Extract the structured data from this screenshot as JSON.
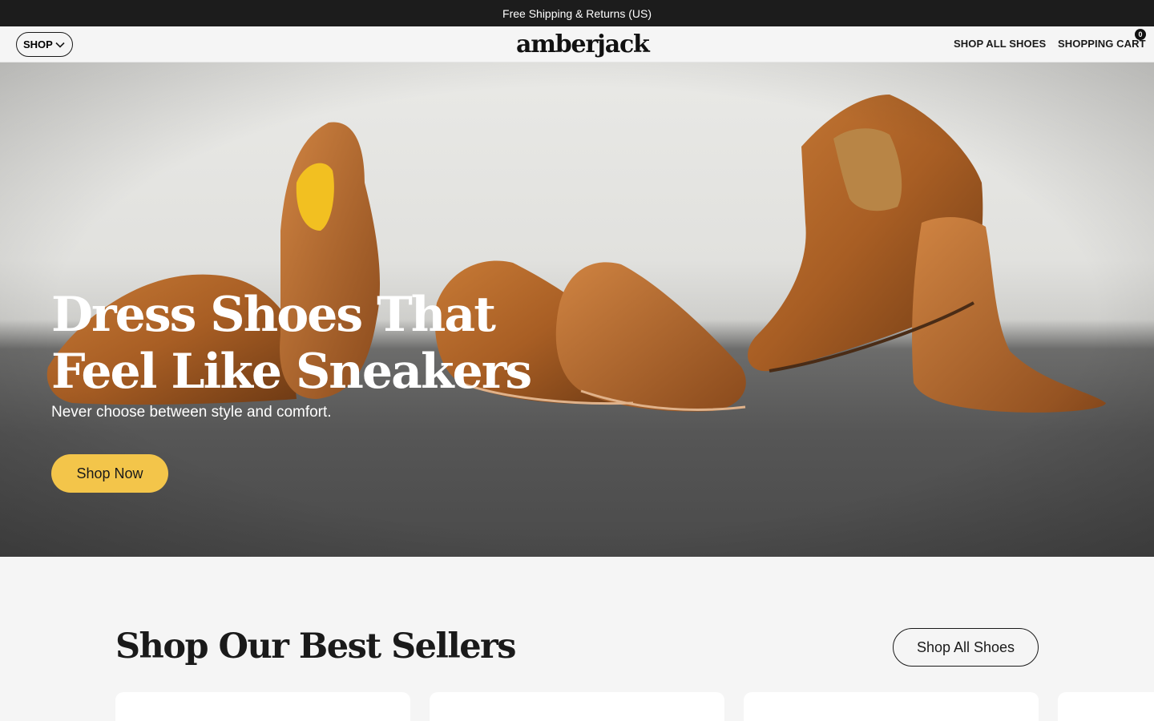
{
  "announcement": {
    "text": "Free Shipping & Returns (US)"
  },
  "header": {
    "shop_label": "SHOP",
    "logo": "amberjack",
    "nav": {
      "shop_all": "SHOP ALL SHOES",
      "cart": "SHOPPING CART"
    },
    "cart_count": "0"
  },
  "hero": {
    "title_line1": "Dress Shoes That",
    "title_line2": "Feel Like Sneakers",
    "subtitle": "Never choose between style and comfort.",
    "cta": "Shop Now",
    "accent_color": "#f3c54a"
  },
  "best_sellers": {
    "title": "Shop Our Best Sellers",
    "button": "Shop All Shoes"
  },
  "icons": {
    "shop_dropdown": "chevron-down-icon"
  }
}
